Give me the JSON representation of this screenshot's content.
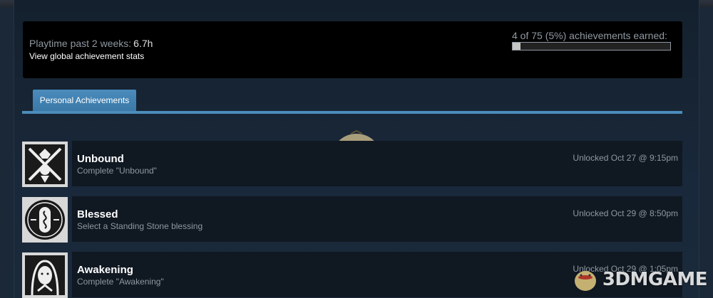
{
  "summary": {
    "playtime_label": "Playtime past 2 weeks:",
    "playtime_value": "6.7h",
    "global_link": "View global achievement stats",
    "achievements_earned": "4 of 75 (5%) achievements earned:",
    "progress_fraction": 0.05
  },
  "tabs": [
    {
      "label": "Personal Achievements",
      "active": true
    }
  ],
  "achievements": [
    {
      "icon": "unbound-icon",
      "title": "Unbound",
      "description": "Complete \"Unbound\"",
      "unlocked": "Unlocked Oct 27 @ 9:15pm"
    },
    {
      "icon": "blessed-icon",
      "title": "Blessed",
      "description": "Select a Standing Stone blessing",
      "unlocked": "Unlocked Oct 29 @ 8:50pm"
    },
    {
      "icon": "awakening-icon",
      "title": "Awakening",
      "description": "Complete \"Awakening\"",
      "unlocked": "Unlocked Oct 29 @ 1:05pm"
    }
  ],
  "watermark": {
    "text": "3DMGAME"
  },
  "colors": {
    "accent": "#4b8cbc",
    "panel": "#000000",
    "row_bg": "#101822",
    "page_bg": "#1b2838"
  }
}
